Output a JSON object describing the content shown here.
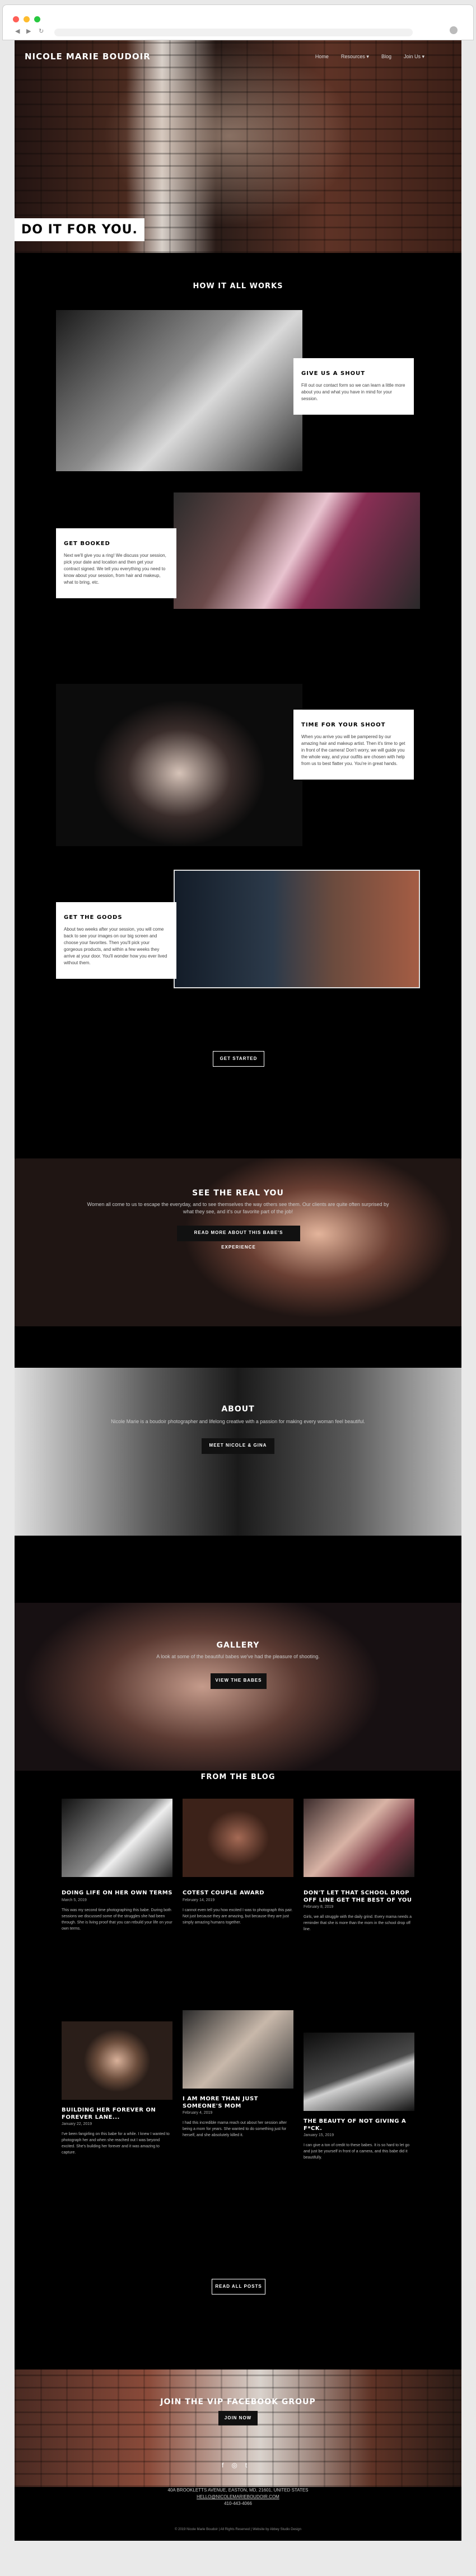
{
  "site": {
    "name": "NICOLE MARIE BOUDOIR",
    "nav": [
      "Home",
      "Resources ▾",
      "Blog",
      "Join Us ▾"
    ],
    "hero_tagline": "DO IT FOR YOU."
  },
  "how": {
    "title": "HOW IT ALL WORKS",
    "steps": [
      {
        "title": "GIVE US A SHOUT",
        "text": "Fill out our contact form so we can learn a little more about you and what you have in mind for your session."
      },
      {
        "title": "GET BOOKED",
        "text": "Next we'll give you a ring! We discuss your session, pick your date and location and then get your contract signed. We tell you everything you need to know about your session, from hair and makeup, what to bring, etc."
      },
      {
        "title": "TIME FOR YOUR SHOOT",
        "text": "When you arrive you will be pampered by our amazing hair and makeup artist. Then it's time to get in front of the camera! Don't worry, we will guide you the whole way, and your outfits are chosen with help from us to best flatter you. You're in great hands."
      },
      {
        "title": "GET THE GOODS",
        "text": "About two weeks after your session, you will come back to see your images on our big screen and choose your favorites. Then you'll pick your gorgeous products, and within a few weeks they arrive at your door. You'll wonder how you ever lived without them."
      }
    ],
    "cta": "GET STARTED"
  },
  "real": {
    "title": "SEE THE REAL YOU",
    "text": "Women all come to us to escape the everyday, and to see themselves the way others see them. Our clients are quite often surprised by what they see, and it's our favorite part of the job!",
    "cta": "READ MORE ABOUT THIS BABE'S EXPERIENCE"
  },
  "about": {
    "title": "ABOUT",
    "text": "Nicole Marie is a boudoir photographer and lifelong creative with a passion for making every woman feel beautiful.",
    "cta": "MEET NICOLE & GINA"
  },
  "gallery": {
    "title": "GALLERY",
    "text": "A look at some of the beautiful babes we've had the pleasure of shooting.",
    "cta": "VIEW THE BABES"
  },
  "blog": {
    "title": "FROM THE BLOG",
    "posts": [
      {
        "title": "DOING LIFE ON HER OWN TERMS",
        "date": "March 5, 2019",
        "excerpt": "This was my second time photographing this babe. During both sessions we discussed some of the struggles she had been through. She is living proof that you can rebuild your life on your own terms."
      },
      {
        "title": "COTEST COUPLE AWARD",
        "date": "February 14, 2019",
        "excerpt": "I cannot even tell you how excited I was to photograph this pair. Not just because they are amazing, but because they are just simply amazing humans together."
      },
      {
        "title": "DON'T LET THAT SCHOOL DROP OFF LINE GET THE BEST OF YOU",
        "date": "February 8, 2019",
        "excerpt": "Girls, we all struggle with the daily grind. Every mama needs a reminder that she is more than the mom in the school drop off line."
      },
      {
        "title": "BUILDING HER FOREVER ON FOREVER LANE...",
        "date": "January 22, 2019",
        "excerpt": "I've been fangirling on this babe for a while. I knew I wanted to photograph her and when she reached out I was beyond excited. She's building her forever and it was amazing to capture."
      },
      {
        "title": "I AM MORE THAN JUST SOMEONE'S MOM",
        "date": "February 4, 2019",
        "excerpt": "I had this incredible mama reach out about her session after being a mom for years. She wanted to do something just for herself, and she absolutely killed it."
      },
      {
        "title": "THE BEAUTY OF NOT GIVING A F*CK.",
        "date": "January 15, 2019",
        "excerpt": "I can give a ton of credit to these babes. It is so hard to let go and just be yourself in front of a camera, and this babe did it beautifully."
      }
    ],
    "cta": "READ ALL POSTS"
  },
  "vip": {
    "title": "JOIN THE VIP FACEBOOK GROUP",
    "cta": "JOIN NOW"
  },
  "footer": {
    "address": "40A BROOKLETTS AVENUE, EASTON, MD, 21601, UNITED STATES",
    "email": "HELLO@NICOLEMARIEBOUDOIR.COM",
    "phone": "410-443-4066",
    "copyright": "© 2019 Nicole Marie Boudoir | All Rights Reserved | Website by Abbey Studio Design",
    "social_icons": [
      "facebook-icon",
      "instagram-icon",
      "twitter-icon"
    ]
  },
  "colors": {
    "page": "#000000",
    "card": "#ffffff",
    "chrome": "#e9e9e9"
  }
}
